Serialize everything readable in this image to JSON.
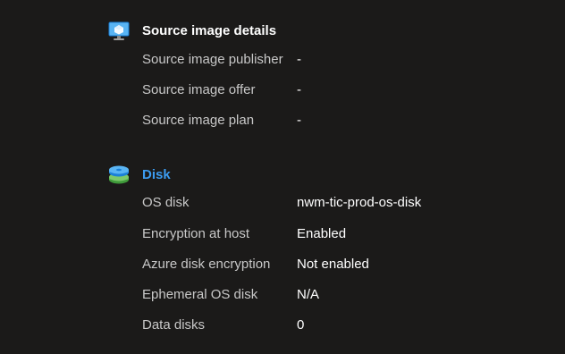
{
  "source_image": {
    "title": "Source image details",
    "icon": "vm-image-icon",
    "rows": [
      {
        "label": "Source image publisher",
        "value": "-"
      },
      {
        "label": "Source image offer",
        "value": "-"
      },
      {
        "label": "Source image plan",
        "value": "-"
      }
    ]
  },
  "disk": {
    "title": "Disk",
    "icon": "disk-icon",
    "rows": [
      {
        "label": "OS disk",
        "value": "nwm-tic-prod-os-disk"
      },
      {
        "label": "Encryption at host",
        "value": "Enabled"
      },
      {
        "label": "Azure disk encryption",
        "value": "Not enabled"
      },
      {
        "label": "Ephemeral OS disk",
        "value": "N/A"
      },
      {
        "label": "Data disks",
        "value": "0"
      }
    ]
  },
  "colors": {
    "background": "#1b1a19",
    "label_text": "#c8c8c8",
    "value_text": "#ffffff",
    "link_accent": "#3c9cf0",
    "disk_icon_green": "#5db54a",
    "disk_icon_blue": "#3c9cf0"
  }
}
